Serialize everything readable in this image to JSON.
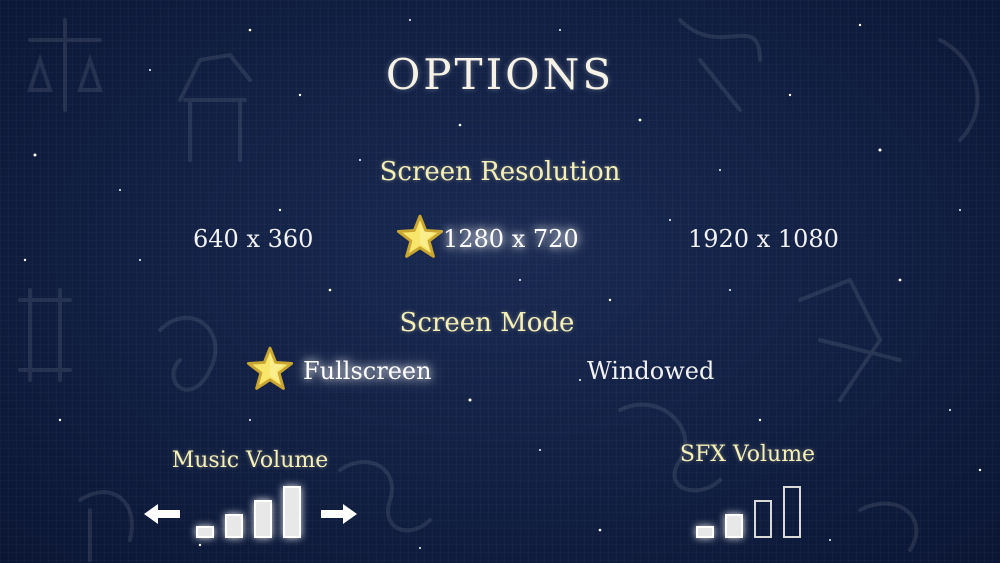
{
  "title": "OPTIONS",
  "resolution": {
    "label": "Screen Resolution",
    "options": [
      "640 x 360",
      "1280 x 720",
      "1920 x 1080"
    ],
    "selected": "1280 x 720"
  },
  "mode": {
    "label": "Screen Mode",
    "options": [
      "Fullscreen",
      "Windowed"
    ],
    "selected": "Fullscreen"
  },
  "music": {
    "label": "Music Volume",
    "level": 4,
    "max": 4
  },
  "sfx": {
    "label": "SFX Volume",
    "level": 2,
    "max": 4
  },
  "colors": {
    "background": "#111f42",
    "label": "#f5f0b6",
    "star": "#f7e66a"
  },
  "icons": {
    "selection": "star-icon",
    "decrease": "arrow-left-icon",
    "increase": "arrow-right-icon"
  }
}
